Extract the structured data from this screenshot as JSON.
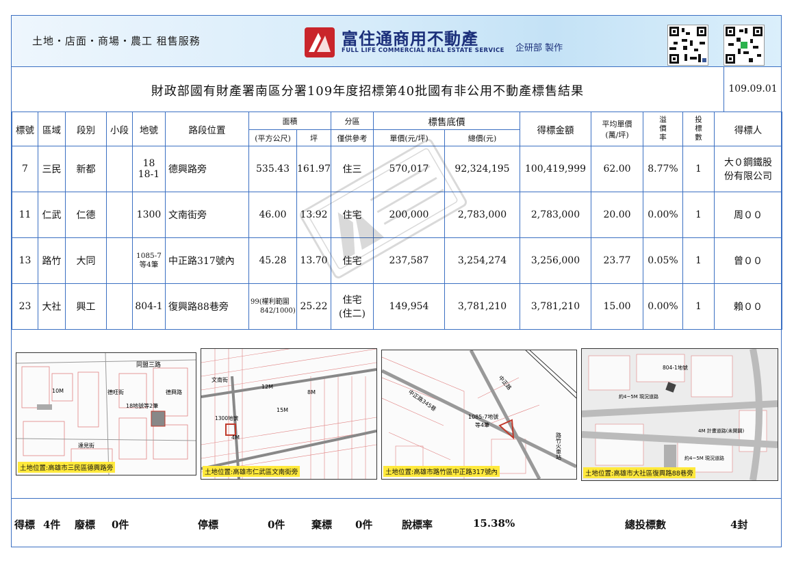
{
  "banner": {
    "services": "土地・店面・商場・農工 租售服務",
    "brand": "富住通商用不動產",
    "brand_en": "FULL LIFE COMMERCIAL REAL ESTATE SERVICE",
    "maker": "企研部 製作"
  },
  "title": "財政部國有財產署南區分署109年度招標第40批國有非公用不動產標售結果",
  "date": "109.09.01",
  "headers": {
    "lot_no": "標號",
    "district": "區域",
    "section": "段別",
    "subsection": "小段",
    "parcel": "地號",
    "location": "路段位置",
    "area": "面積",
    "area_m2": "(平方公尺)",
    "area_ping": "坪",
    "zoning": "分區",
    "zoning_note": "僅供參考",
    "floor_price": "標售底價",
    "unit_price": "單價(元/坪)",
    "total_price": "總價(元)",
    "winning_amount": "得標金額",
    "avg_unit_price_1": "平均單價",
    "avg_unit_price_2": "(萬/坪)",
    "premium_1": "溢",
    "premium_2": "價",
    "premium_3": "率",
    "bids_1": "投",
    "bids_2": "標",
    "bids_3": "數",
    "winner": "得標人"
  },
  "rows": [
    {
      "lot_no": "7",
      "district": "三民",
      "section": "新都",
      "subsection": "",
      "parcel_1": "18",
      "parcel_2": "18-1",
      "location": "德興路旁",
      "area_m2": "535.43",
      "area_ping": "161.97",
      "zoning_1": "住三",
      "zoning_2": "",
      "unit_price": "570,017",
      "total_price": "92,324,195",
      "winning_amount": "100,419,999",
      "avg_unit_price": "62.00",
      "premium": "8.77%",
      "bids": "1",
      "winner_1": "大０鋼鐵股",
      "winner_2": "份有限公司"
    },
    {
      "lot_no": "11",
      "district": "仁武",
      "section": "仁德",
      "subsection": "",
      "parcel_1": "1300",
      "parcel_2": "",
      "location": "文南街旁",
      "area_m2": "46.00",
      "area_ping": "13.92",
      "zoning_1": "住宅",
      "zoning_2": "",
      "unit_price": "200,000",
      "total_price": "2,783,000",
      "winning_amount": "2,783,000",
      "avg_unit_price": "20.00",
      "premium": "0.00%",
      "bids": "1",
      "winner_1": "周００",
      "winner_2": ""
    },
    {
      "lot_no": "13",
      "district": "路竹",
      "section": "大同",
      "subsection": "",
      "parcel_1": "1085-7",
      "parcel_2": "等4筆",
      "location": "中正路317號內",
      "area_m2": "45.28",
      "area_ping": "13.70",
      "zoning_1": "住宅",
      "zoning_2": "",
      "unit_price": "237,587",
      "total_price": "3,254,274",
      "winning_amount": "3,256,000",
      "avg_unit_price": "23.77",
      "premium": "0.05%",
      "bids": "1",
      "winner_1": "曾００",
      "winner_2": ""
    },
    {
      "lot_no": "23",
      "district": "大社",
      "section": "興工",
      "subsection": "",
      "parcel_1": "804-1",
      "parcel_2": "",
      "location": "復興路88巷旁",
      "area_m2_1": "99(權利範圍",
      "area_m2_2": "842/1000)",
      "area_ping": "25.22",
      "zoning_1": "住宅",
      "zoning_2": "(住二)",
      "unit_price": "149,954",
      "total_price": "3,781,210",
      "winning_amount": "3,781,210",
      "avg_unit_price": "15.00",
      "premium": "0.00%",
      "bids": "1",
      "winner_1": "賴００",
      "winner_2": ""
    }
  ],
  "maps": [
    {
      "caption": "土地位置:高雄市三民區德興路旁",
      "labels": [
        "同盟三路",
        "10M",
        "德旺街",
        "18地號等2筆",
        "德興路",
        "達見街"
      ]
    },
    {
      "caption": "土地位置:高雄市仁武區文南街旁",
      "labels": [
        "文南街",
        "12M",
        "8M",
        "15M",
        "1300地號",
        "4M"
      ]
    },
    {
      "caption": "土地位置:高雄市路竹區中正路317號內",
      "labels": [
        "中正路345巷",
        "中正路",
        "1085-7地號",
        "等4筆",
        "路竹火車站"
      ]
    },
    {
      "caption": "土地位置:高雄市大社區復興路88巷旁",
      "labels": [
        "804-1地號",
        "約4~5M 現況道路",
        "4M 計畫道路(未開闢)",
        "約4~5M 現況道路"
      ]
    }
  ],
  "footer": {
    "won_label": "得標",
    "won_value": "4件",
    "void_label": "廢標",
    "void_value": "0件",
    "suspended_label": "停標",
    "suspended_value": "0件",
    "abandoned_label": "棄標",
    "abandoned_value": "0件",
    "unsold_rate_label": "脫標率",
    "unsold_rate_value": "15.38%",
    "total_bids_label": "總投標數",
    "total_bids_value": "4封"
  },
  "colors": {
    "border": "#3a6fc2",
    "brand": "#1b2f7a",
    "logo": "#c9252b",
    "caption_bg": "#ffe93c",
    "parcel_line": "#c0392b"
  }
}
